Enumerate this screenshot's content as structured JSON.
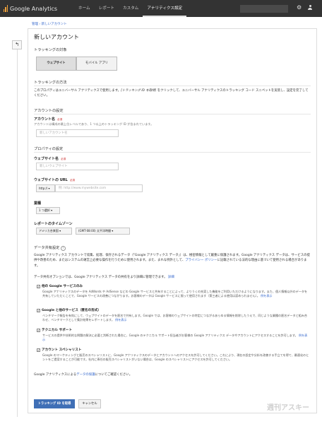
{
  "app": {
    "name": "Google Analytics"
  },
  "nav": {
    "tabs": [
      {
        "label": "ホーム"
      },
      {
        "label": "レポート"
      },
      {
        "label": "カスタム"
      },
      {
        "label": "アナリティクス設定"
      }
    ]
  },
  "breadcrumb": "管理 › 新しいアカウント",
  "page": {
    "title": "新しいアカウント"
  },
  "tracking_target": {
    "heading": "トラッキングの対象",
    "options": [
      {
        "label": "ウェブサイト"
      },
      {
        "label": "モバイル アプリ"
      }
    ]
  },
  "tracking_method": {
    "heading": "トラッキングの方法",
    "text_before": "このプロパティはユニバーサル アナリティクスで使用します。",
    "text_italic": "[トラッキング ID を取得]",
    "text_after": " をクリックして、ユニバーサル アナリティクスのトラッキング コード スニペットを実装し、設定を完了してください。"
  },
  "account_settings": {
    "heading": "アカウントの設定",
    "name_label": "アカウント名",
    "required": "必須",
    "help": "アカウントは構成の最上位レベルであり、1 つ以上のトラッキング ID が含まれています。",
    "placeholder": "新しいアカウント名"
  },
  "property_settings": {
    "heading": "プロパティの設定",
    "site_name_label": "ウェブサイト名",
    "site_name_placeholder": "新しいウェブサイト",
    "url_label": "ウェブサイトの URL",
    "protocol": "http:// ▾",
    "url_placeholder": "例: http://www.mywebsite.com",
    "industry_label": "業種",
    "industry_value": "1 つ選択 ▾",
    "timezone_label": "レポートのタイムゾーン",
    "country": "アメリカ合衆国 ▾",
    "timezone": "(GMT-08:00) 太平洋時間 ▾"
  },
  "data_sharing": {
    "heading": "データ共有設定",
    "help_icon": "?",
    "intro": "Google アナリティクス アカウントで収集、処理、保存されるデータ（「Google アナリティクス データ」）は、極密情報として厳重に保護されます。Google アナリティクス データは、サービスの提供や改善のため、またはシステムの運営上必要な操作を行うために使用されます。また、まれな例外として、",
    "policy_link": "プライバシー ポリシー",
    "intro_end": "に記載されている法的な理由に基づいて使用される場合があります。",
    "option_line": "データ共有オプションでは、Google アナリティクス データの共有をより詳細に管理できます。",
    "option_link": "詳細",
    "items": [
      {
        "check": "✓",
        "label": "他の Google サービスのみ",
        "desc": "Google アナリティクスのデータを AdWords や AdSense などの Google サービスと共有することによって、よりうくの充実した機能をご利用いただけるようになります。また、個人情報以外のデータを共有していただくことで、Google サービスの改善につながります。お客様のデータは Google サービスに限って使用されます（第三者による使用は認められません）。",
        "more": "例を表示"
      },
      {
        "check": "✓",
        "label": "Google と他のサービス（匿名の形式）",
        "desc": "ベンチマーク報告を有効にして、ウェブサイトのデータを匿名で共有します。Google では、お客様のウェブサイトの特定につながるあらゆる情報を削除したうえで、同じような業種の匿名データと組み合わせ、ベンチマークとして集計結果をレポートします。",
        "more": "例を表示"
      },
      {
        "check": "✓",
        "label": "テクニカル サポート",
        "desc": "サービスの提供や技術的な問題の解決に必要と判断された場合に、Google のテクニカル サポート担当者がお客様の Google アナリティクス データやアカウントにアクセスすることを許可します。",
        "more": "例を表示"
      },
      {
        "check": "✓",
        "label": "アカウント スペシャリスト",
        "desc": "Google のマーケティングと販売のスペシャリストに、Google アナリティクスのデータとアカウントへのアクセスを許可してください。これにより、現在の設定や分析を改善する手立てを得て、最適化のヒントをご提案することが可能です。社内に専任の販売スペシャリストがいない場合は、Google のスペシャリストにアクセスを許可してください。",
        "more": ""
      }
    ],
    "footer_before": "Google アナリティクスによる",
    "footer_link": "データの保護",
    "footer_after": "についてご確認ください。"
  },
  "buttons": {
    "submit": "トラッキング ID を取得",
    "cancel": "キャンセル"
  },
  "watermark": "週刊アスキー",
  "colors": {
    "topbar": "#333333",
    "primary": "#3f6fb6",
    "link": "#3366cc"
  }
}
